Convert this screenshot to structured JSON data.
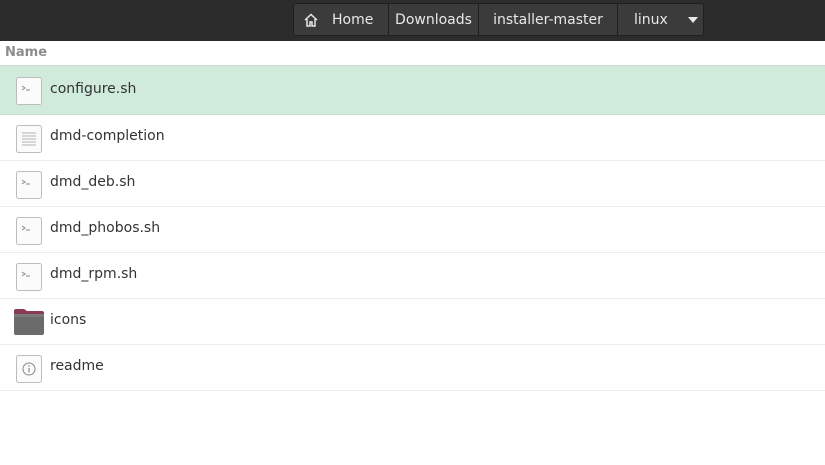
{
  "breadcrumbs": [
    {
      "label": "Home",
      "icon": "home-icon"
    },
    {
      "label": "Downloads"
    },
    {
      "label": "installer-master"
    },
    {
      "label": "linux",
      "icon": "caret-down-icon"
    }
  ],
  "column_header": "Name",
  "files": [
    {
      "name": "configure.sh",
      "type": "script",
      "selected": true
    },
    {
      "name": "dmd-completion",
      "type": "text"
    },
    {
      "name": "dmd_deb.sh",
      "type": "script"
    },
    {
      "name": "dmd_phobos.sh",
      "type": "script"
    },
    {
      "name": "dmd_rpm.sh",
      "type": "script"
    },
    {
      "name": "icons",
      "type": "folder"
    },
    {
      "name": "readme",
      "type": "info"
    }
  ],
  "colors": {
    "selection": "#d0eadc",
    "toolbar": "#2c2c2c",
    "folder": "#6b6b6b",
    "folder_tab": "#8a3b53"
  }
}
